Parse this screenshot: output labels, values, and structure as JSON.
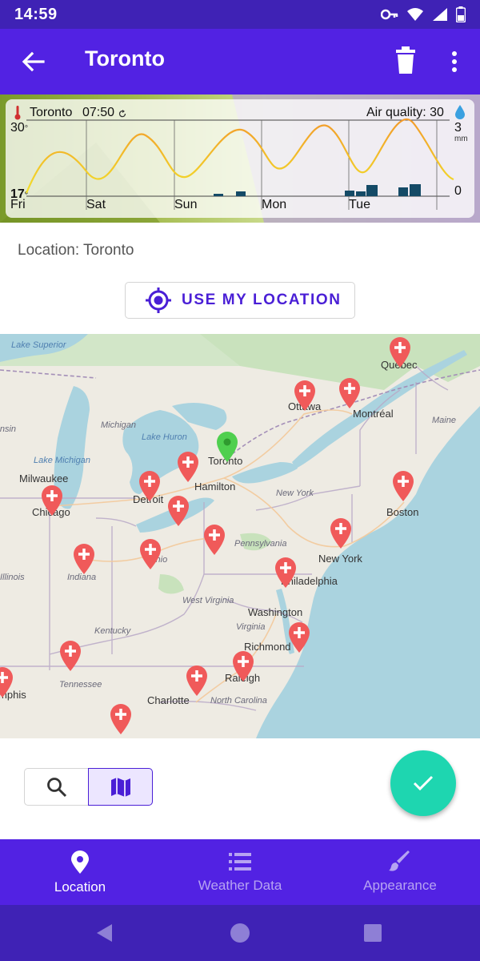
{
  "status_bar": {
    "time": "14:59"
  },
  "app_bar": {
    "title": "Toronto"
  },
  "widget": {
    "location": "Toronto",
    "time": "07:50",
    "air_quality": "Air quality: 30",
    "temp_max": "30",
    "temp_max_unit": "°",
    "temp_min": "17",
    "temp_min_unit": "°",
    "precip_max": "3",
    "precip_unit": "mm",
    "precip_min": "0",
    "days": [
      "Fri",
      "Sat",
      "Sun",
      "Mon",
      "Tue"
    ]
  },
  "location_section": {
    "label": "Location: Toronto",
    "use_location_button": "USE MY LOCATION"
  },
  "map": {
    "cities": [
      "Toronto",
      "Hamilton",
      "Ottawa",
      "Montréal",
      "Québec",
      "Boston",
      "New York",
      "Philadelphia",
      "Washington",
      "Richmond",
      "Raleigh",
      "Charlotte",
      "Chicago",
      "Milwaukee",
      "Detroit",
      "Indiana",
      "Ohio"
    ],
    "regions": [
      "Michigan",
      "Lake Huron",
      "Lake Superior",
      "Lake Michigan",
      "Pennsylvania",
      "New York",
      "West Virginia",
      "Virginia",
      "Kentucky",
      "Tennessee",
      "North Carolina",
      "Maine",
      "Illinois",
      "Wisconsin",
      "Memphis"
    ],
    "colors": {
      "pin": "#f05a5a",
      "current_pin": "#4fcf4f",
      "water": "#aad3df",
      "land": "#eeebe3"
    }
  },
  "search_toggle": {
    "selected": "map"
  },
  "bottom_nav": {
    "items": [
      {
        "label": "Location",
        "icon": "location-pin-icon",
        "active": true
      },
      {
        "label": "Weather Data",
        "icon": "list-icon",
        "active": false
      },
      {
        "label": "Appearance",
        "icon": "brush-icon",
        "active": false
      }
    ]
  },
  "theme": {
    "primary": "#5222e3",
    "primary_dark": "#3f22b5",
    "accent": "#1ed6b0"
  }
}
